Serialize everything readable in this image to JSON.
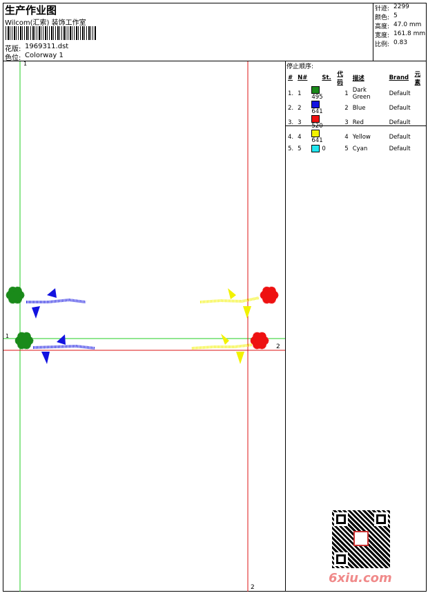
{
  "header": {
    "title": "生产作业图",
    "studio": "Wilcom(汇索) 装饰工作室",
    "design_label": "花版:",
    "design_value": "1969311.dst",
    "colorway_label": "色位:",
    "colorway_value": "Colorway 1"
  },
  "stats": [
    {
      "label": "针迹:",
      "value": "2299"
    },
    {
      "label": "颜色:",
      "value": "5"
    },
    {
      "label": "高度:",
      "value": "47.0 mm"
    },
    {
      "label": "宽度:",
      "value": "161.8 mm"
    },
    {
      "label": "比例:",
      "value": "0.83"
    }
  ],
  "sequence": {
    "title": "停止顺序:",
    "columns": [
      "#",
      "N#",
      "St.",
      "代码",
      "描述",
      "Brand",
      "元素"
    ],
    "rows": [
      {
        "idx": "1.",
        "n": "1",
        "color": "#1a8a1a",
        "st": "495",
        "code": "1",
        "desc": "Dark Green",
        "brand": "Default"
      },
      {
        "idx": "2.",
        "n": "2",
        "color": "#1212e0",
        "st": "641",
        "code": "2",
        "desc": "Blue",
        "brand": "Default"
      },
      {
        "idx": "3.",
        "n": "3",
        "color": "#ee1111",
        "st": "520",
        "code": "3",
        "desc": "Red",
        "brand": "Default"
      },
      {
        "idx": "4.",
        "n": "4",
        "color": "#f2f200",
        "st": "641",
        "code": "4",
        "desc": "Yellow",
        "brand": "Default"
      },
      {
        "idx": "5.",
        "n": "5",
        "color": "#22e6f0",
        "st": "0",
        "code": "5",
        "desc": "Cyan",
        "brand": "Default"
      }
    ]
  },
  "guides": {
    "green_label_top": "1",
    "green_label_left": "1",
    "red_label_right": "2",
    "red_label_bottom": "2",
    "green_color": "#22cc22",
    "red_color": "#dd1111"
  },
  "watermark": "6xiu.com",
  "colors": {
    "green": "#1a8a1a",
    "blue": "#1212e0",
    "red": "#ee1111",
    "yellow": "#f2f200"
  }
}
